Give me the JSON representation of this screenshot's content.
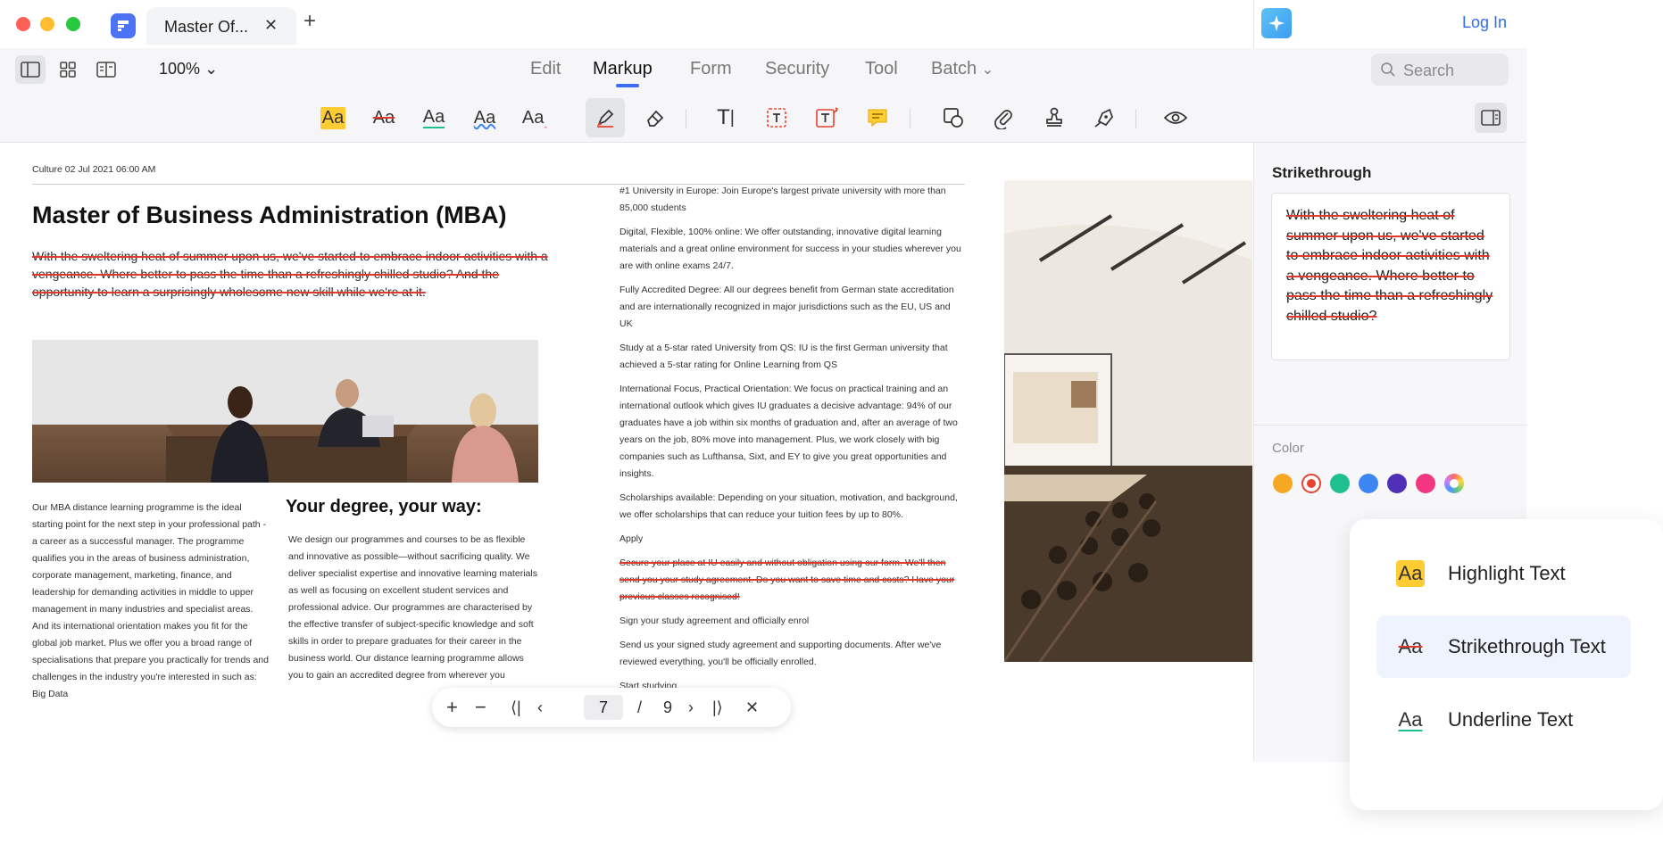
{
  "tab": {
    "title": "Master Of...",
    "close": "✕",
    "add": "+"
  },
  "header": {
    "login": "Log In"
  },
  "toolbar": {
    "zoom": "100%",
    "menus": [
      "Edit",
      "Markup",
      "Form",
      "Security",
      "Tool",
      "Batch"
    ],
    "active_menu": "Markup",
    "search_placeholder": "Search",
    "markup_tools": {
      "aa_highlight": "Aa",
      "aa_strike": "Aa",
      "aa_underline": "Aa",
      "aa_squiggly": "Aa",
      "aa_replace": "Aa",
      "text_tool": "T"
    }
  },
  "document": {
    "meta": "Culture 02 Jul 2021 06:00 AM",
    "title": "Master of Business Administration (MBA)",
    "intro_struck": "With the sweltering heat of summer upon us, we've started to embrace indoor activities with a vengeance. Where better to pass the time than a refreshingly chilled studio? And the opportunity to learn a surprisingly wholesome new skill while we're at it.",
    "col1": "Our MBA distance learning programme is the ideal starting point for the next step in your professional path - a career as a successful manager. The programme qualifies you in the areas of business administration, corporate management, marketing, finance, and leadership for demanding activities in middle to upper management in many industries and specialist areas. And its international orientation makes you fit for the global job market. Plus we offer you a broad range of specialisations that prepare you practically for trends and challenges in the industry you're interested in such as: Big Data",
    "col2_heading": "Your degree, your way:",
    "col2": "We design our programmes and courses to be as flexible and innovative as possible—without sacrificing quality. We deliver specialist expertise and innovative learning materials as well as focusing on excellent student services and professional advice. Our programmes are characterised by the effective transfer of subject-specific knowledge and soft skills in order to prepare graduates for their career in the business world. Our distance learning programme allows you to gain an accredited degree from wherever you",
    "col3": [
      "#1 University in Europe: Join Europe's largest private university with more than 85,000 students",
      "Digital, Flexible, 100% online: We offer outstanding, innovative digital learning materials and a great online environment for success in your studies wherever you are with online exams 24/7.",
      "Fully Accredited Degree: All our degrees benefit from German state accreditation and are internationally recognized in major jurisdictions such as the EU, US and UK",
      "Study at a 5-star rated University from QS: IU is the first German university that achieved a 5-star rating for Online Learning from QS",
      "International Focus, Practical Orientation: We focus on practical training and an international outlook which gives IU graduates a decisive advantage: 94% of our graduates have a job within six months of graduation and, after an average of two years on the job, 80% move into management. Plus, we work closely with big companies such as Lufthansa, Sixt, and EY to give you great opportunities and insights.",
      "Scholarships available: Depending on your situation, motivation, and background, we offer scholarships that can reduce your tuition fees by up to 80%.",
      "Apply"
    ],
    "col3_struck": "Secure your place at IU easily and without obligation using our form. We'll then send you your study agreement. Do you want to save time and costs? Have your previous classes recognised!",
    "col3_after": [
      "Sign your study agreement and officially enrol",
      "Send us your signed study agreement and supporting documents. After we've reviewed everything, you'll be officially enrolled.",
      "Start studying"
    ]
  },
  "pager": {
    "current": "7",
    "separator": "/",
    "total": "9"
  },
  "panel": {
    "title": "Strikethrough",
    "preview": "With the sweltering heat of summer upon us, we've started to embrace indoor activities with a vengeance. Where better to pass the time than a refreshingly chilled studio?",
    "color_label": "Color",
    "colors": [
      "#f7a823",
      "#e8432f",
      "#1fbf8f",
      "#3b86f2",
      "#4f2fb5",
      "#f2367f",
      "rainbow"
    ],
    "selected_color": "#e8432f"
  },
  "card": {
    "items": [
      {
        "icon": "Aa",
        "label": "Highlight Text"
      },
      {
        "icon": "Aa",
        "label": "Strikethrough Text"
      },
      {
        "icon": "Aa",
        "label": "Underline Text"
      }
    ],
    "active_index": 1
  }
}
